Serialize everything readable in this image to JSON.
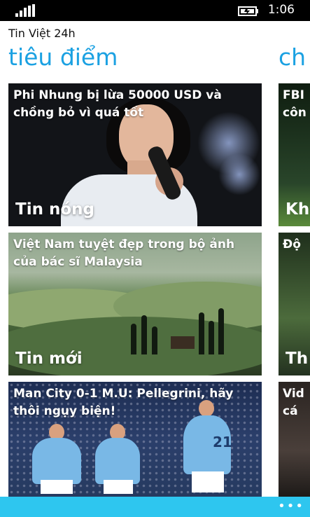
{
  "status": {
    "time": "1:06"
  },
  "app": {
    "title": "Tin Việt 24h"
  },
  "pivot": {
    "active": "tiêu điểm",
    "next_peek": "ch"
  },
  "tiles": [
    {
      "headline": "Phi Nhung bị lừa 50000 USD và chồng bỏ vì quá tốt",
      "category": "Tin nóng"
    },
    {
      "headline": "Việt Nam tuyệt đẹp trong bộ ảnh của bác sĩ Malaysia",
      "category": "Tin mới"
    },
    {
      "headline": "Man City 0-1 M.U: Pellegrini, hãy thôi ngụy biện!",
      "category": ""
    }
  ],
  "peek_tiles": [
    {
      "headline_line1": "FBI",
      "headline_line2": "côn",
      "category": "Kh"
    },
    {
      "headline_line1": "Độ",
      "headline_line2": "",
      "category": "Th"
    },
    {
      "headline_line1": "Vid",
      "headline_line2": "cá",
      "category": ""
    }
  ],
  "app_bar": {
    "more": "•••",
    "color": "#2ec6ef"
  },
  "colors": {
    "accent": "#1ba1e2"
  },
  "icons": [
    "signal-strength-icon",
    "battery-charging-icon",
    "more-ellipsis-icon"
  ]
}
